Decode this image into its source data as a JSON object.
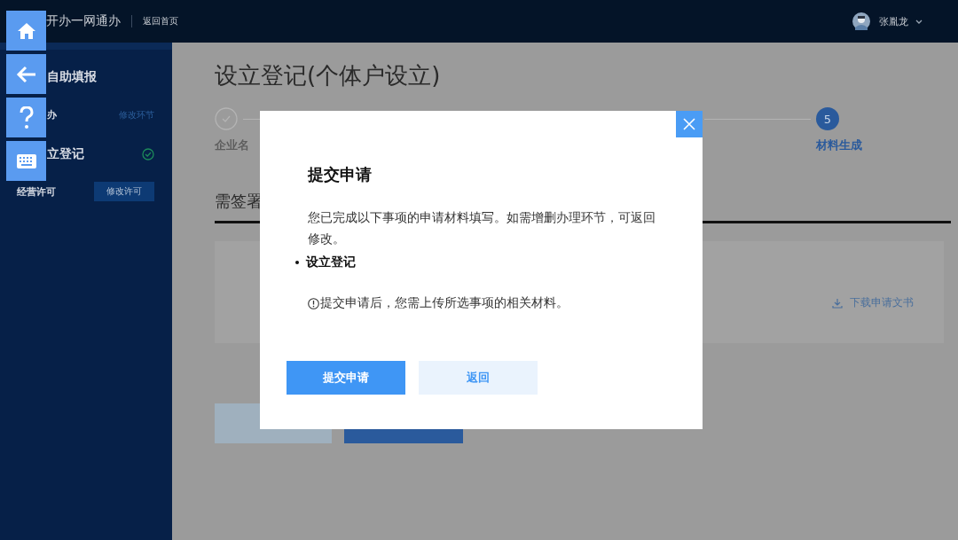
{
  "header": {
    "title": "开办一网通办",
    "home_link": "返回首页",
    "user": {
      "name": "张胤龙"
    }
  },
  "sidebar": {
    "heading": "自助填报",
    "items": [
      {
        "kind": "link",
        "label": "办",
        "action": "修改环节"
      },
      {
        "kind": "section",
        "label": "立登记",
        "done": true
      },
      {
        "kind": "button",
        "label": "经营许可",
        "action": "修改许可"
      }
    ]
  },
  "main": {
    "title": "设立登记(个体户设立)",
    "steps": [
      {
        "kind": "done",
        "label": "企业名"
      },
      {
        "kind": "current",
        "number": "5",
        "label": "材料生成"
      }
    ],
    "section_title": "需签署",
    "card": {
      "download": "下载申请文书"
    }
  },
  "dialog": {
    "title": "提交申请",
    "message": "您已完成以下事项的申请材料填写。如需增删办理环节，可返回修改。",
    "items": [
      "设立登记"
    ],
    "note": "提交申请后，您需上传所选事项的相关材料。",
    "buttons": [
      {
        "label": "提交申请",
        "primary": true
      },
      {
        "label": "返回",
        "primary": false
      }
    ]
  }
}
